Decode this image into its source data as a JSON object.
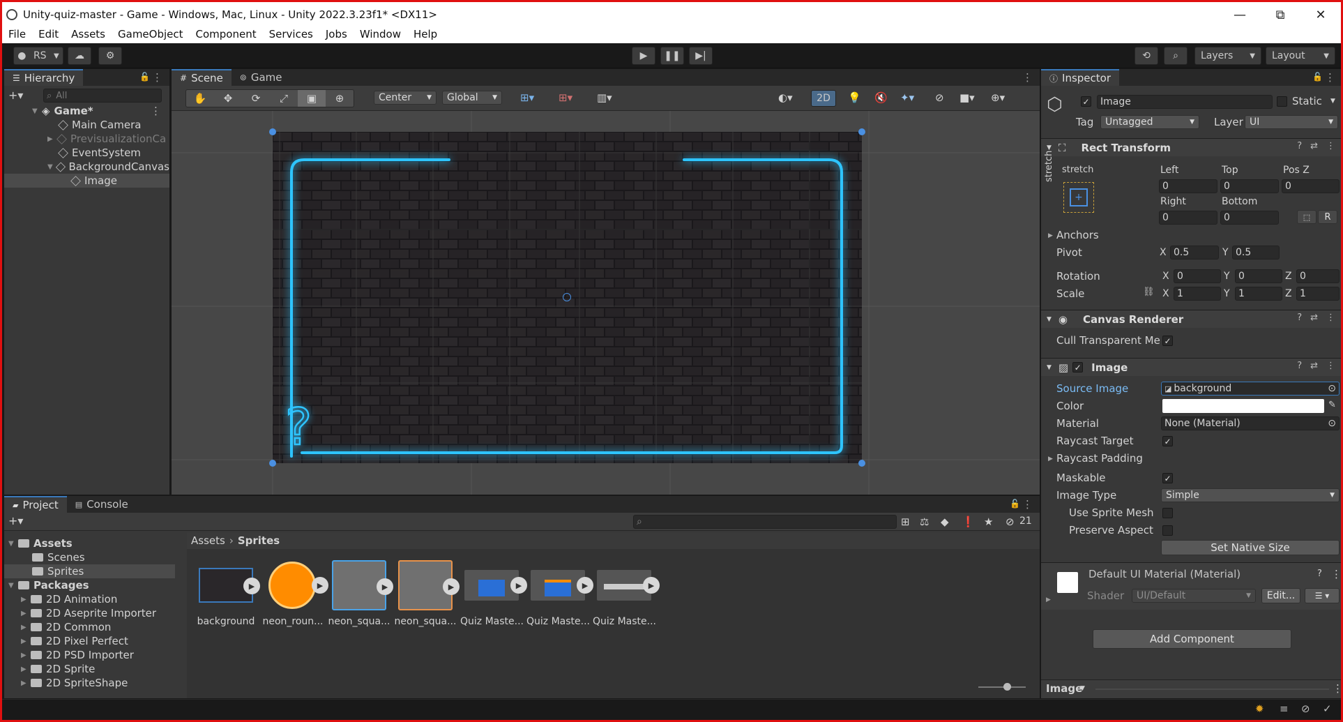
{
  "window": {
    "title": "Unity-quiz-master - Game - Windows, Mac, Linux - Unity 2022.3.23f1* <DX11>",
    "minimize": "—",
    "maximize": "⧉",
    "close": "✕"
  },
  "menu": [
    "File",
    "Edit",
    "Assets",
    "GameObject",
    "Component",
    "Services",
    "Jobs",
    "Window",
    "Help"
  ],
  "toolbar": {
    "account": "RS",
    "layers": "Layers",
    "layout": "Layout"
  },
  "hierarchy": {
    "tab": "Hierarchy",
    "search_placeholder": "All",
    "items": [
      {
        "label": "Game*",
        "depth": 0,
        "bold": true
      },
      {
        "label": "Main Camera",
        "depth": 1
      },
      {
        "label": "PrevisualizationCa",
        "depth": 1,
        "dim": true
      },
      {
        "label": "EventSystem",
        "depth": 1
      },
      {
        "label": "BackgroundCanvas",
        "depth": 1
      },
      {
        "label": "Image",
        "depth": 2,
        "selected": true
      }
    ]
  },
  "scene": {
    "tabs": [
      "Scene",
      "Game"
    ],
    "pivot": "Center",
    "space": "Global",
    "mode2d": "2D"
  },
  "inspector": {
    "tab": "Inspector",
    "object_name": "Image",
    "static_label": "Static",
    "tag_label": "Tag",
    "tag": "Untagged",
    "layer_label": "Layer",
    "layer": "UI",
    "rect": {
      "title": "Rect Transform",
      "stretch_top": "stretch",
      "stretch_side": "stretch",
      "left_label": "Left",
      "left": "0",
      "top_label": "Top",
      "top": "0",
      "posz_label": "Pos Z",
      "posz": "0",
      "right_label": "Right",
      "right": "0",
      "bottom_label": "Bottom",
      "bottom": "0",
      "anchors": "Anchors",
      "pivot_label": "Pivot",
      "pivot_x": "0.5",
      "pivot_y": "0.5",
      "rotation_label": "Rotation",
      "rot_x": "0",
      "rot_y": "0",
      "rot_z": "0",
      "scale_label": "Scale",
      "scale_x": "1",
      "scale_y": "1",
      "scale_z": "1",
      "x": "X",
      "y": "Y",
      "z": "Z",
      "r_btn": "R"
    },
    "canvas_renderer": {
      "title": "Canvas Renderer",
      "cull": "Cull Transparent Me"
    },
    "image": {
      "title": "Image",
      "source_label": "Source Image",
      "source": "background",
      "color_label": "Color",
      "material_label": "Material",
      "material": "None (Material)",
      "raycast_target": "Raycast Target",
      "raycast_padding": "Raycast Padding",
      "maskable": "Maskable",
      "image_type_label": "Image Type",
      "image_type": "Simple",
      "use_sprite_mesh": "Use Sprite Mesh",
      "preserve_aspect": "Preserve Aspect",
      "native": "Set Native Size"
    },
    "material": {
      "title": "Default UI Material (Material)",
      "shader_label": "Shader",
      "shader": "UI/Default",
      "edit": "Edit..."
    },
    "add_component": "Add Component",
    "footer": "Image"
  },
  "project": {
    "tabs": [
      "Project",
      "Console"
    ],
    "hidden_count": "21",
    "breadcrumb": [
      "Assets",
      "Sprites"
    ],
    "tree": [
      {
        "label": "Assets",
        "depth": 0,
        "bold": true
      },
      {
        "label": "Scenes",
        "depth": 1
      },
      {
        "label": "Sprites",
        "depth": 1,
        "selected": true
      },
      {
        "label": "Packages",
        "depth": 0,
        "bold": true
      },
      {
        "label": "2D Animation",
        "depth": 1
      },
      {
        "label": "2D Aseprite Importer",
        "depth": 1
      },
      {
        "label": "2D Common",
        "depth": 1
      },
      {
        "label": "2D Pixel Perfect",
        "depth": 1
      },
      {
        "label": "2D PSD Importer",
        "depth": 1
      },
      {
        "label": "2D Sprite",
        "depth": 1
      },
      {
        "label": "2D SpriteShape",
        "depth": 1
      }
    ],
    "assets": [
      {
        "name": "background",
        "kind": "brick"
      },
      {
        "name": "neon_roun...",
        "kind": "circle"
      },
      {
        "name": "neon_squa...",
        "kind": "square-blue"
      },
      {
        "name": "neon_squa...",
        "kind": "square-orange"
      },
      {
        "name": "Quiz Maste...",
        "kind": "quiz1"
      },
      {
        "name": "Quiz Maste...",
        "kind": "quiz2"
      },
      {
        "name": "Quiz Maste...",
        "kind": "quiz3"
      }
    ]
  },
  "colors": {
    "accent": "#3a79bb",
    "neon": "#2ec4ff",
    "orange": "#ff8c00"
  }
}
